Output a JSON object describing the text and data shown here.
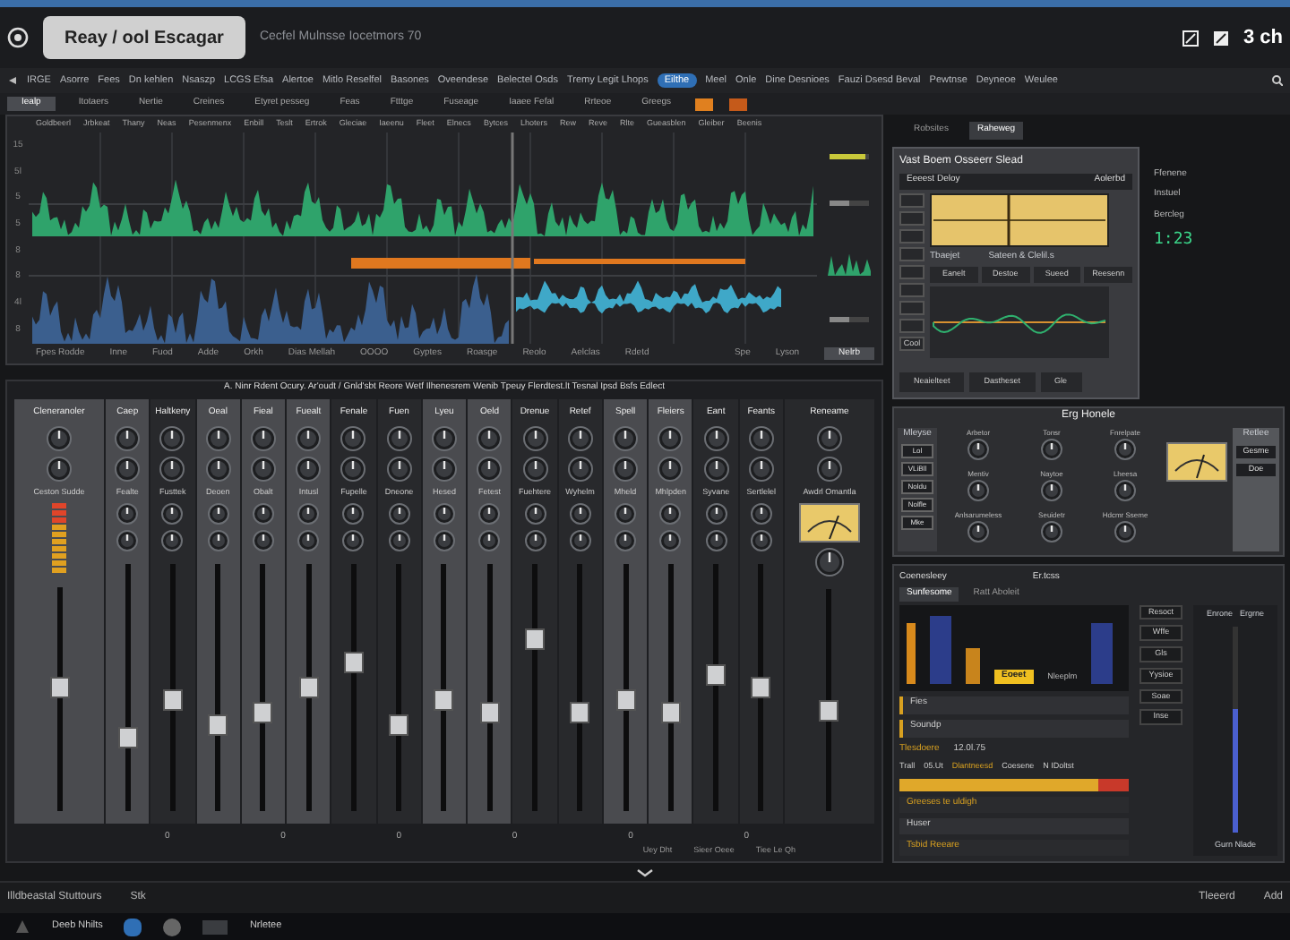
{
  "title_bar": {
    "project_button": "Reay / ool Escagar",
    "subtitle": "Cecfel Mulnsse Iocetmors 70",
    "corner_text": "3 ch"
  },
  "menu": [
    {
      "label": "IRGE",
      "selected": false
    },
    {
      "label": "Asorre",
      "selected": false
    },
    {
      "label": "Fees",
      "selected": false
    },
    {
      "label": "Dn kehlen",
      "selected": false
    },
    {
      "label": "Nsaszp",
      "selected": false
    },
    {
      "label": "LCGS Efsa",
      "selected": false
    },
    {
      "label": "Alertoe",
      "selected": false
    },
    {
      "label": "Mitlo Reselfel",
      "selected": false
    },
    {
      "label": "Basones",
      "selected": false
    },
    {
      "label": "Oveendese",
      "selected": false
    },
    {
      "label": "Belectel Osds",
      "selected": false
    },
    {
      "label": "Tremy Legit Lhops",
      "selected": false
    },
    {
      "label": "Eilthe",
      "selected": true
    },
    {
      "label": "Meel",
      "selected": false
    },
    {
      "label": "Onle",
      "selected": false
    },
    {
      "label": "Dine Desnioes",
      "selected": false
    },
    {
      "label": "Fauzi Dsesd Beval",
      "selected": false
    },
    {
      "label": "Pewtnse",
      "selected": false
    },
    {
      "label": "Deyneoe",
      "selected": false
    },
    {
      "label": "Weulee",
      "selected": false
    }
  ],
  "toolbar": [
    {
      "label": "Iealp",
      "selected": true
    },
    {
      "label": "Itotaers",
      "selected": false
    },
    {
      "label": "Nertie",
      "selected": false
    },
    {
      "label": "Creines",
      "selected": false
    },
    {
      "label": "Etyret pesseg",
      "selected": false
    },
    {
      "label": "Feas",
      "selected": false
    },
    {
      "label": "Ftttge",
      "selected": false
    },
    {
      "label": "Fuseage",
      "selected": false
    },
    {
      "label": "Iaaee Fefal",
      "selected": false
    },
    {
      "label": "Rrteoe",
      "selected": false
    },
    {
      "label": "Greegs",
      "selected": false
    }
  ],
  "timeline": {
    "markers": [
      "Goldbeerl",
      "Jrbkeat",
      "Thany",
      "Neas",
      "Pesenmenx",
      "Enbill",
      "Teslt",
      "Ertrok",
      "Gleciae",
      "Iaeenu",
      "Fleet",
      "Elnecs",
      "Bytces",
      "Lhoters",
      "Rew",
      "Reve",
      "Rlte",
      "Gueasblen",
      "Gleiber",
      "Beenis"
    ],
    "y_labels": [
      "15",
      "5l",
      "5",
      "5",
      "8",
      "8",
      "4l",
      "8"
    ],
    "footer": [
      "Fpes Rodde",
      "Inne",
      "Fuod",
      "Adde",
      "Orkh",
      "Dias Mellah",
      "OOOO",
      "Gyptes",
      "Roasge",
      "Reolo",
      "Aelclas",
      "Rdetd"
    ],
    "side_labels": [
      "Spe",
      "Lyson"
    ],
    "side_button": "Nelrb",
    "side_sliders": [
      {
        "level": 0.9
      },
      {
        "level": 0.5
      },
      {
        "level": 0.5
      }
    ]
  },
  "mixer": {
    "heading": "A. Ninr Rdent Ocury. Ar'oudt / Gnld'sbt Reore Wetf Ilhenesrem  Wenib  Tpeuy Flerdtest.lt  Tesnal Ipsd  Bsfs Edlect",
    "strips": [
      {
        "kind": "meter",
        "name": "Cleneranoler",
        "label": "Ceston Sudde",
        "highlighted": true,
        "level": 0.55
      },
      {
        "kind": "channel",
        "name": "Caep",
        "label": "Fealte",
        "highlighted": true,
        "level": 0.3
      },
      {
        "kind": "channel",
        "name": "Haltkeny",
        "label": "Fusttek",
        "highlighted": false,
        "level": 0.45
      },
      {
        "kind": "channel",
        "name": "Oeal",
        "label": "Deoen",
        "highlighted": true,
        "level": 0.35
      },
      {
        "kind": "channel",
        "name": "Fieal",
        "label": "Obalt",
        "highlighted": true,
        "level": 0.4
      },
      {
        "kind": "channel",
        "name": "Fuealt",
        "label": "Intusl",
        "highlighted": true,
        "level": 0.5
      },
      {
        "kind": "channel",
        "name": "Fenale",
        "label": "Fupelle",
        "highlighted": false,
        "level": 0.6
      },
      {
        "kind": "channel",
        "name": "Fuen",
        "label": "Dneone",
        "highlighted": false,
        "level": 0.35
      },
      {
        "kind": "channel",
        "name": "Lyeu",
        "label": "Hesed",
        "highlighted": true,
        "level": 0.45
      },
      {
        "kind": "channel",
        "name": "Oeld",
        "label": "Fetest",
        "highlighted": true,
        "level": 0.4
      },
      {
        "kind": "channel",
        "name": "Drenue",
        "label": "Fuehtere",
        "highlighted": false,
        "level": 0.7
      },
      {
        "kind": "channel",
        "name": "Retef",
        "label": "Wyhelm",
        "highlighted": false,
        "level": 0.4
      },
      {
        "kind": "channel",
        "name": "Spell",
        "label": "Mheld",
        "highlighted": true,
        "level": 0.45
      },
      {
        "kind": "channel",
        "name": "Fleiers",
        "label": "Mhlpden",
        "highlighted": true,
        "level": 0.4
      },
      {
        "kind": "channel",
        "name": "Eant",
        "label": "Syvane",
        "highlighted": false,
        "level": 0.55
      },
      {
        "kind": "channel",
        "name": "Feants",
        "label": "Sertlelel",
        "highlighted": false,
        "level": 0.5
      },
      {
        "kind": "vu",
        "name": "Reneame",
        "label": "Awdrl Omantla",
        "highlighted": false,
        "level": 0.45
      }
    ],
    "fader_readouts": [
      "0",
      "0",
      "0",
      "0",
      "0",
      "0"
    ],
    "footer": [
      "Uey Dht",
      "Sieer Oeee",
      "Tiee Le Qh"
    ]
  },
  "plugin": {
    "tabs": [
      {
        "label": "Robsites",
        "selected": false
      },
      {
        "label": "Raheweg",
        "selected": true
      }
    ],
    "title": "Vast Boem Osseerr Slead",
    "preset": "Eeeest Deloy",
    "preset_right": "Aolerbd",
    "labels": [
      "Tbaejet",
      "Sateen & Clelil.s"
    ],
    "buttons": [
      "Eanelt",
      "Destoe",
      "Sueed",
      "Reesenn"
    ],
    "footer_buttons": [
      "Neaielteet",
      "Dastheset",
      "Gle"
    ],
    "side": [
      "Ffenene",
      "Instuel",
      "Bercleg"
    ],
    "readout": "1:23",
    "side_button": "Cool"
  },
  "ergo": {
    "title": "Erg Honele",
    "left_title": "Mleyse",
    "left_buttons": [
      "Lol",
      "VLiBll",
      "Noldu",
      "Nolfle",
      "Mke"
    ],
    "knobs": [
      "Arbetor",
      "Tonsr",
      "Fnrelpate",
      "Mentiv",
      "Naytoe",
      "Lheesa",
      "Anlsarumeless",
      "Seuidetr",
      "Hdcmr Sseme"
    ],
    "right_title": "Retlee",
    "right_buttons": [
      "Gesme",
      "Doe"
    ]
  },
  "analyzer": {
    "title": "Coenesleey",
    "subtitle": "Er.tcss",
    "tabs": [
      {
        "label": "Sunfesome",
        "selected": true
      },
      {
        "label": "Ratt Aboleit",
        "selected": false
      }
    ],
    "badge": "Eoeet",
    "badge_note": "Nleeplm",
    "rows": [
      "Fies",
      "Soundp"
    ],
    "time_label": "Tlesdoere",
    "time": "12.0l.75",
    "stats": [
      "Trall",
      "05.Ut",
      "Dlantneesd",
      "Coesene",
      "N IDoltst"
    ],
    "level": 0.87,
    "lower": [
      "Greeses te uldigh",
      "Huser",
      "Tsbid Reeare"
    ],
    "buttons": [
      "Resoct",
      "Wffe",
      "Gls",
      "Yysioe",
      "Soae",
      "Inse"
    ],
    "right_tabs": [
      "Enrone",
      "Ergrne"
    ],
    "right_note": "Gurn Nlade"
  },
  "status_bar": {
    "left": "Illdbeastal Stuttours",
    "mid": "Stk",
    "right": [
      "Tleeerd",
      "Add"
    ]
  },
  "taskbar": {
    "items": [
      "Deeb Nhilts",
      "Nrletee"
    ]
  }
}
